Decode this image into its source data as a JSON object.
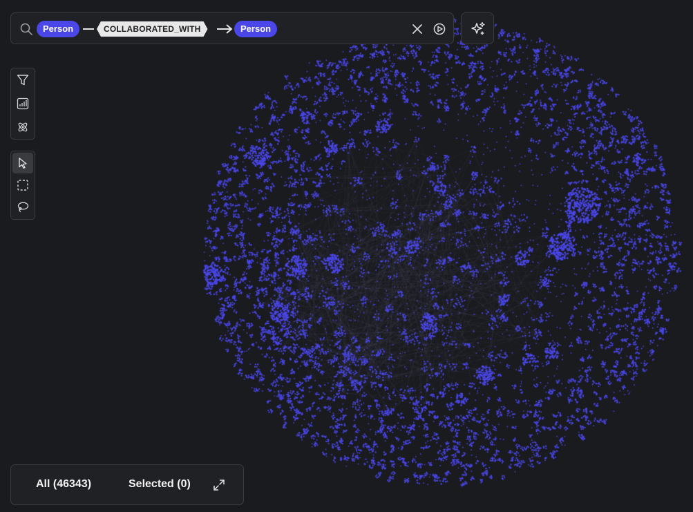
{
  "search": {
    "start_node_label": "Person",
    "relationship_type": "COLLABORATED_WITH",
    "end_node_label": "Person"
  },
  "bottom_bar": {
    "all_label": "All (46343)",
    "selected_label": "Selected (0)"
  },
  "colors": {
    "node": "#4a46e8",
    "background": "#1a1b1e",
    "panel": "#202124",
    "panel_border": "#3b3c40",
    "relationship_tag": "#e8e8e8"
  },
  "icons": {
    "search": "search-icon",
    "clear": "close-icon",
    "run": "play-circle-icon",
    "ai": "sparkles-icon",
    "filter": "filter-icon",
    "stats": "bar-chart-icon",
    "layout": "atom-icon",
    "select": "pointer-icon",
    "box_select": "dashed-square-icon",
    "lasso": "lasso-icon",
    "expand": "expand-arrows-icon"
  }
}
